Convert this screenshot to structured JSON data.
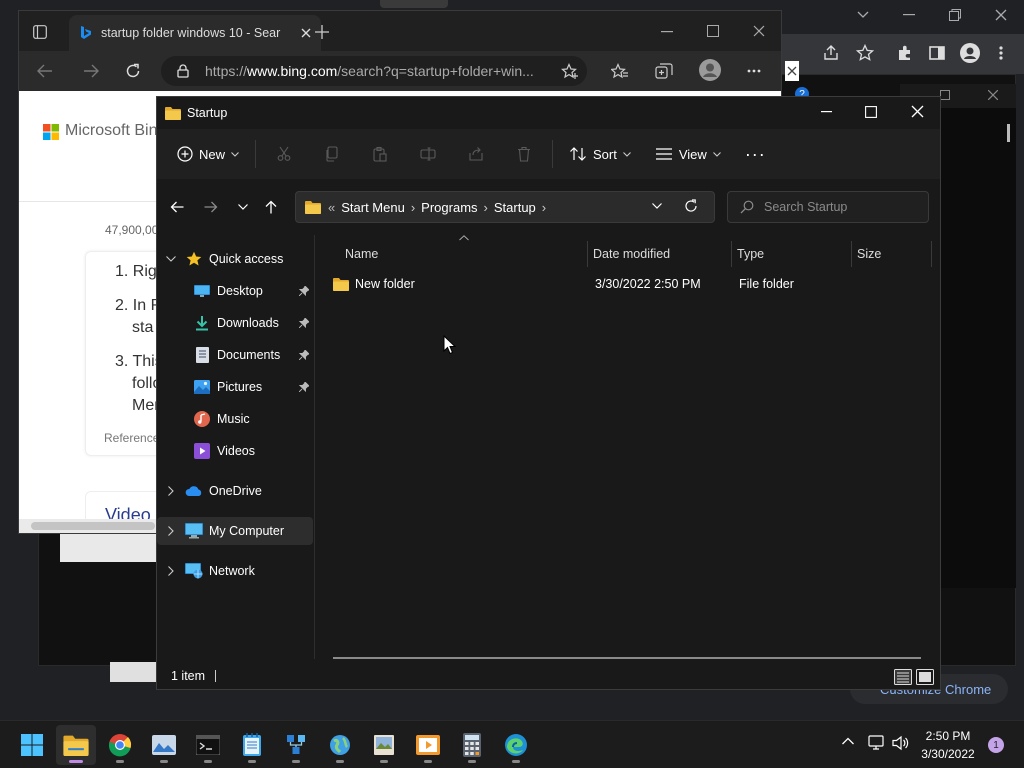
{
  "chrome_background": {
    "customize_label": "Customize Chrome"
  },
  "edge": {
    "tab_title": "startup folder windows 10 - Sear",
    "url_prefix": "https://",
    "url_domain": "www.bing.com",
    "url_rest": "/search?q=startup+folder+win...",
    "brand": "Microsoft Bing",
    "result_count": "47,900,00",
    "list_items": [
      "1. Rig",
      "2. In R",
      "sta",
      "3. This",
      "follo",
      "Men"
    ],
    "references_label": "Reference",
    "video_label": "Video"
  },
  "explorer": {
    "window_title": "Startup",
    "toolbar": {
      "new_label": "New",
      "sort_label": "Sort",
      "view_label": "View",
      "more_label": "···"
    },
    "breadcrumb": {
      "overflow": "«",
      "parts": [
        "Start Menu",
        "Programs",
        "Startup"
      ],
      "separator": "›"
    },
    "search_placeholder": "Search Startup",
    "nav": {
      "quick_access": "Quick access",
      "desktop": "Desktop",
      "downloads": "Downloads",
      "documents": "Documents",
      "pictures": "Pictures",
      "music": "Music",
      "videos": "Videos",
      "onedrive": "OneDrive",
      "my_computer": "My Computer",
      "network": "Network"
    },
    "columns": {
      "name": "Name",
      "date_modified": "Date modified",
      "type": "Type",
      "size": "Size"
    },
    "files": [
      {
        "name": "New folder",
        "date_modified": "3/30/2022 2:50 PM",
        "type": "File folder",
        "size": ""
      }
    ],
    "status": "1 item"
  },
  "taskbar": {
    "time": "2:50 PM",
    "date": "3/30/2022",
    "notification_count": "1"
  },
  "colors": {
    "folder_yellow": "#f4c84a",
    "accent_blue": "#4cc2ff",
    "explorer_bg": "#191919"
  }
}
